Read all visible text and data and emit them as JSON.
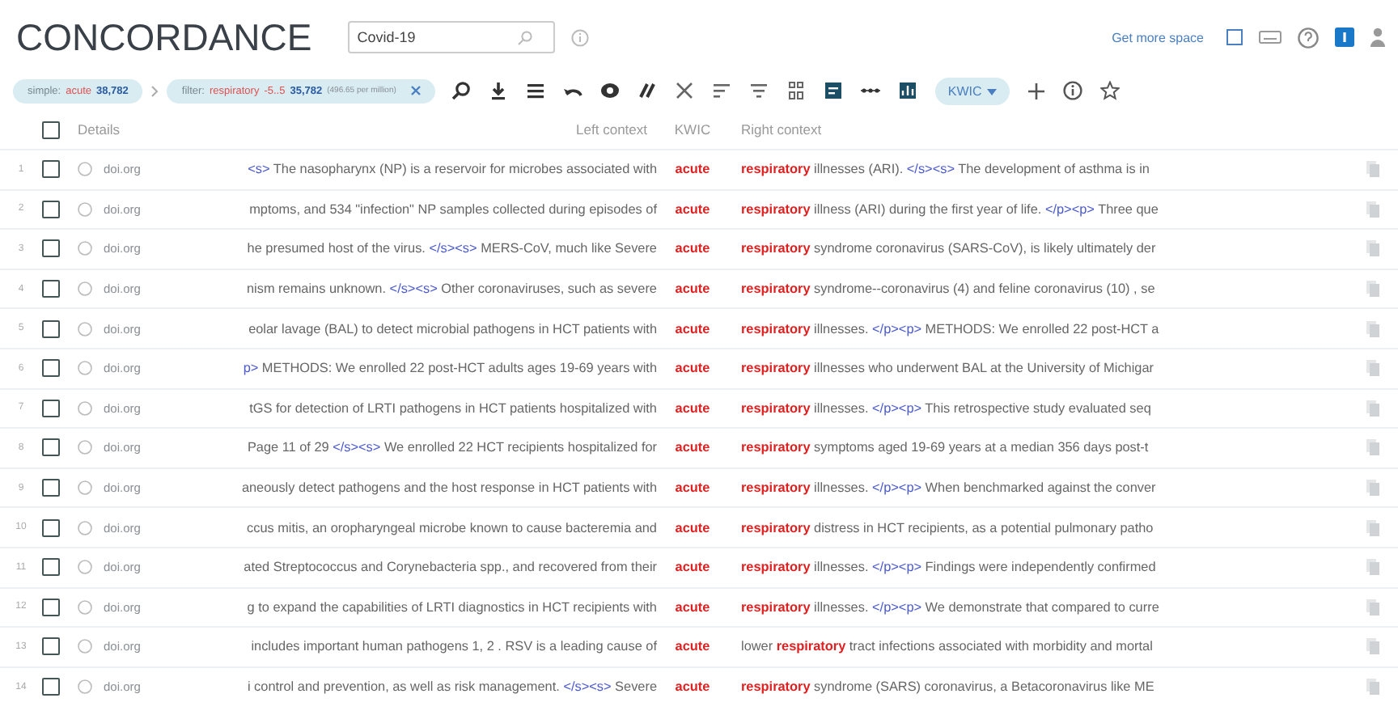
{
  "app": {
    "title": "CONCORDANCE",
    "search": {
      "value": "Covid-19"
    },
    "top_link": "Get more space"
  },
  "query": [
    {
      "parts": [
        {
          "kind": "label",
          "text": "simple:"
        },
        {
          "kind": "term",
          "text": "acute"
        },
        {
          "kind": "count",
          "text": "38,782"
        }
      ],
      "closable": false
    },
    {
      "parts": [
        {
          "kind": "label",
          "text": "filter:"
        },
        {
          "kind": "term",
          "text": "respiratory"
        },
        {
          "kind": "term",
          "text": "-5..5"
        },
        {
          "kind": "count",
          "text": "35,782"
        },
        {
          "kind": "note",
          "text": "(496.65 per million)"
        }
      ],
      "closable": true
    }
  ],
  "view_menu": {
    "label": "KWIC"
  },
  "table": {
    "header_checked": false,
    "columns": [
      "Details",
      "Left context",
      "KWIC",
      "Right context"
    ],
    "rows": [
      {
        "num": "1",
        "checked": false,
        "source": "doi.org",
        "left": [
          {
            "kind": "tag",
            "text": "<s>"
          },
          {
            "kind": "plain",
            "text": " The nasopharynx (NP) is a reservoir for microbes associated with"
          }
        ],
        "kwic": "acute",
        "right": [
          {
            "kind": "hit",
            "text": "respiratory"
          },
          {
            "kind": "plain",
            "text": " illnesses (ARI). "
          },
          {
            "kind": "tag",
            "text": "</s><s>"
          },
          {
            "kind": "plain",
            "text": " The development of asthma is in"
          }
        ]
      },
      {
        "num": "2",
        "checked": false,
        "source": "doi.org",
        "left": [
          {
            "kind": "plain",
            "text": "mptoms, and 534 \"infection\" NP samples collected during episodes of"
          }
        ],
        "kwic": "acute",
        "right": [
          {
            "kind": "hit",
            "text": "respiratory"
          },
          {
            "kind": "plain",
            "text": " illness (ARI) during the first year of life. "
          },
          {
            "kind": "tag",
            "text": "</p><p>"
          },
          {
            "kind": "plain",
            "text": " Three que"
          }
        ]
      },
      {
        "num": "3",
        "checked": false,
        "source": "doi.org",
        "left": [
          {
            "kind": "plain",
            "text": "he presumed host of the virus. "
          },
          {
            "kind": "tag",
            "text": "</s><s>"
          },
          {
            "kind": "plain",
            "text": " MERS-CoV, much like Severe"
          }
        ],
        "kwic": "acute",
        "right": [
          {
            "kind": "hit",
            "text": "respiratory"
          },
          {
            "kind": "plain",
            "text": " syndrome coronavirus (SARS-CoV), is likely ultimately der"
          }
        ]
      },
      {
        "num": "4",
        "checked": false,
        "source": "doi.org",
        "left": [
          {
            "kind": "plain",
            "text": "nism remains unknown. "
          },
          {
            "kind": "tag",
            "text": "</s><s>"
          },
          {
            "kind": "plain",
            "text": " Other coronaviruses, such as severe"
          }
        ],
        "kwic": "acute",
        "right": [
          {
            "kind": "hit",
            "text": "respiratory"
          },
          {
            "kind": "plain",
            "text": " syndrome--coronavirus (4) and feline coronavirus (10) , se"
          }
        ]
      },
      {
        "num": "5",
        "checked": false,
        "source": "doi.org",
        "left": [
          {
            "kind": "plain",
            "text": "eolar lavage (BAL) to detect microbial pathogens in HCT patients with"
          }
        ],
        "kwic": "acute",
        "right": [
          {
            "kind": "hit",
            "text": "respiratory"
          },
          {
            "kind": "plain",
            "text": " illnesses. "
          },
          {
            "kind": "tag",
            "text": "</p><p>"
          },
          {
            "kind": "plain",
            "text": " METHODS: We enrolled 22 post-HCT a"
          }
        ]
      },
      {
        "num": "6",
        "checked": false,
        "source": "doi.org",
        "left": [
          {
            "kind": "tag",
            "text": "p>"
          },
          {
            "kind": "plain",
            "text": " METHODS: We enrolled 22 post-HCT adults ages 19-69 years with"
          }
        ],
        "kwic": "acute",
        "right": [
          {
            "kind": "hit",
            "text": "respiratory"
          },
          {
            "kind": "plain",
            "text": " illnesses who underwent BAL at the University of Michigar"
          }
        ]
      },
      {
        "num": "7",
        "checked": false,
        "source": "doi.org",
        "left": [
          {
            "kind": "plain",
            "text": "tGS for detection of LRTI pathogens in HCT patients hospitalized with"
          }
        ],
        "kwic": "acute",
        "right": [
          {
            "kind": "hit",
            "text": "respiratory"
          },
          {
            "kind": "plain",
            "text": " illnesses. "
          },
          {
            "kind": "tag",
            "text": "</p><p>"
          },
          {
            "kind": "plain",
            "text": " This retrospective study evaluated seq"
          }
        ]
      },
      {
        "num": "8",
        "checked": false,
        "source": "doi.org",
        "left": [
          {
            "kind": "plain",
            "text": "Page 11 of 29 "
          },
          {
            "kind": "tag",
            "text": "</s><s>"
          },
          {
            "kind": "plain",
            "text": " We enrolled 22 HCT recipients hospitalized for"
          }
        ],
        "kwic": "acute",
        "right": [
          {
            "kind": "hit",
            "text": "respiratory"
          },
          {
            "kind": "plain",
            "text": " symptoms aged 19-69 years at a median 356 days post-t"
          }
        ]
      },
      {
        "num": "9",
        "checked": false,
        "source": "doi.org",
        "left": [
          {
            "kind": "plain",
            "text": "aneously detect pathogens and the host response in HCT patients with"
          }
        ],
        "kwic": "acute",
        "right": [
          {
            "kind": "hit",
            "text": "respiratory"
          },
          {
            "kind": "plain",
            "text": " illnesses. "
          },
          {
            "kind": "tag",
            "text": "</p><p>"
          },
          {
            "kind": "plain",
            "text": " When benchmarked against the conver"
          }
        ]
      },
      {
        "num": "10",
        "checked": false,
        "source": "doi.org",
        "left": [
          {
            "kind": "plain",
            "text": "ccus mitis, an oropharyngeal microbe known to cause bacteremia and"
          }
        ],
        "kwic": "acute",
        "right": [
          {
            "kind": "hit",
            "text": "respiratory"
          },
          {
            "kind": "plain",
            "text": " distress in HCT recipients, as a potential pulmonary patho"
          }
        ]
      },
      {
        "num": "11",
        "checked": false,
        "source": "doi.org",
        "left": [
          {
            "kind": "plain",
            "text": "ated Streptococcus and Corynebacteria spp., and recovered from their"
          }
        ],
        "kwic": "acute",
        "right": [
          {
            "kind": "hit",
            "text": "respiratory"
          },
          {
            "kind": "plain",
            "text": " illnesses. "
          },
          {
            "kind": "tag",
            "text": "</p><p>"
          },
          {
            "kind": "plain",
            "text": " Findings were independently confirmed"
          }
        ]
      },
      {
        "num": "12",
        "checked": false,
        "source": "doi.org",
        "left": [
          {
            "kind": "plain",
            "text": "g to expand the capabilities of LRTI diagnostics in HCT recipients with"
          }
        ],
        "kwic": "acute",
        "right": [
          {
            "kind": "hit",
            "text": "respiratory"
          },
          {
            "kind": "plain",
            "text": " illnesses. "
          },
          {
            "kind": "tag",
            "text": "</p><p>"
          },
          {
            "kind": "plain",
            "text": " We demonstrate that compared to curre"
          }
        ]
      },
      {
        "num": "13",
        "checked": false,
        "source": "doi.org",
        "left": [
          {
            "kind": "plain",
            "text": "includes important human pathogens 1, 2 . RSV is a leading cause of"
          }
        ],
        "kwic": "acute",
        "right": [
          {
            "kind": "plain",
            "text": "lower "
          },
          {
            "kind": "hit",
            "text": "respiratory"
          },
          {
            "kind": "plain",
            "text": " tract infections associated with morbidity and mortal"
          }
        ]
      },
      {
        "num": "14",
        "checked": false,
        "source": "doi.org",
        "left": [
          {
            "kind": "plain",
            "text": "i control and prevention, as well as risk management. "
          },
          {
            "kind": "tag",
            "text": "</s><s>"
          },
          {
            "kind": "plain",
            "text": " Severe"
          }
        ],
        "kwic": "acute",
        "right": [
          {
            "kind": "hit",
            "text": "respiratory"
          },
          {
            "kind": "plain",
            "text": " syndrome (SARS) coronavirus, a Betacoronavirus like ME"
          }
        ]
      }
    ]
  }
}
